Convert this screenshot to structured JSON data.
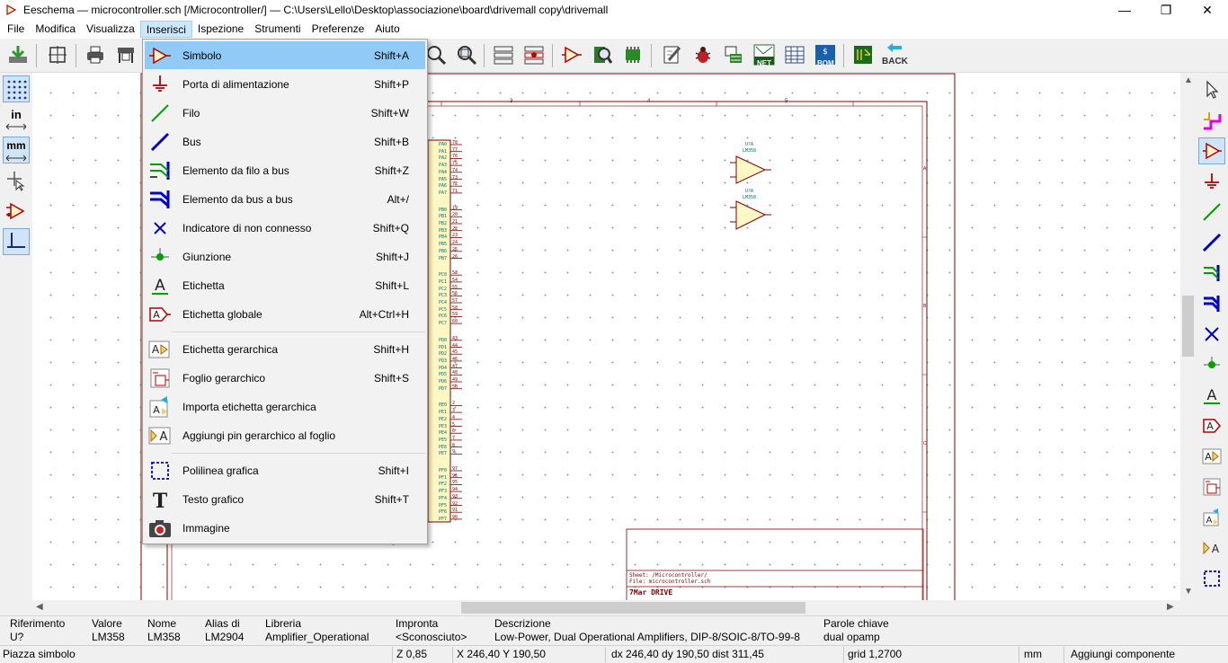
{
  "window": {
    "title": "Eeschema — microcontroller.sch [/Microcontroller/] — C:\\Users\\Lello\\Desktop\\associazione\\board\\drivemall copy\\drivemall",
    "minimize": "—",
    "restore": "❐",
    "close": "✕"
  },
  "menubar": [
    {
      "label": "File"
    },
    {
      "label": "Modifica"
    },
    {
      "label": "Visualizza"
    },
    {
      "label": "Inserisci"
    },
    {
      "label": "Ispezione"
    },
    {
      "label": "Strumenti"
    },
    {
      "label": "Preferenze"
    },
    {
      "label": "Aiuto"
    }
  ],
  "insert_menu": [
    {
      "label": "Simbolo",
      "shortcut": "Shift+A",
      "icon": "symbol-icon"
    },
    {
      "label": "Porta di alimentazione",
      "shortcut": "Shift+P",
      "icon": "power-port-icon"
    },
    {
      "label": "Filo",
      "shortcut": "Shift+W",
      "icon": "wire-icon"
    },
    {
      "label": "Bus",
      "shortcut": "Shift+B",
      "icon": "bus-icon"
    },
    {
      "label": "Elemento da filo a bus",
      "shortcut": "Shift+Z",
      "icon": "wire-to-bus-icon"
    },
    {
      "label": "Elemento da bus a bus",
      "shortcut": "Alt+/",
      "icon": "bus-to-bus-icon"
    },
    {
      "label": "Indicatore di non connesso",
      "shortcut": "Shift+Q",
      "icon": "no-connect-icon"
    },
    {
      "label": "Giunzione",
      "shortcut": "Shift+J",
      "icon": "junction-icon"
    },
    {
      "label": "Etichetta",
      "shortcut": "Shift+L",
      "icon": "label-icon"
    },
    {
      "label": "Etichetta globale",
      "shortcut": "Alt+Ctrl+H",
      "icon": "global-label-icon"
    },
    {
      "label": "Etichetta gerarchica",
      "shortcut": "Shift+H",
      "icon": "hier-label-icon"
    },
    {
      "label": "Foglio gerarchico",
      "shortcut": "Shift+S",
      "icon": "hier-sheet-icon"
    },
    {
      "label": "Importa etichetta gerarchica",
      "shortcut": "",
      "icon": "import-hier-label-icon"
    },
    {
      "label": "Aggiungi pin gerarchico al foglio",
      "shortcut": "",
      "icon": "add-hier-pin-icon"
    },
    {
      "label": "Polilinea grafica",
      "shortcut": "Shift+I",
      "icon": "polyline-icon"
    },
    {
      "label": "Testo grafico",
      "shortcut": "Shift+T",
      "icon": "text-icon"
    },
    {
      "label": "Immagine",
      "shortcut": "",
      "icon": "camera-icon"
    }
  ],
  "toolbar": {
    "back_label": "BACK",
    "net_label": "NET",
    "bom_label": "BOM"
  },
  "left_toolbar": {
    "units_in": "in",
    "units_mm": "mm"
  },
  "schematic": {
    "opamp1_ref": "U?A",
    "opamp1_val": "LM358",
    "opamp2_ref": "U?A",
    "opamp2_val": "LM358",
    "sheet_text": "Sheet: /Microcontroller/",
    "file_text": "File: microcontroller.sch",
    "title_text": "7Mar DRIVE",
    "frame_cols": [
      "3",
      "4",
      "5"
    ],
    "frame_rows": [
      "A",
      "B",
      "C"
    ],
    "ic_pins": [
      "PA0",
      "PA1",
      "PA2",
      "PA3",
      "PA4",
      "PA5",
      "PA6",
      "PA7",
      "PB0",
      "PB1",
      "PB2",
      "PB3",
      "PB4",
      "PB5",
      "PB6",
      "PB7",
      "PC0",
      "PC1",
      "PC2",
      "PC3",
      "PC4",
      "PC5",
      "PC6",
      "PC7",
      "PD0",
      "PD1",
      "PD2",
      "PD3",
      "PD4",
      "PD5",
      "PD6",
      "PD7",
      "PE0",
      "PE1",
      "PE2",
      "PE3",
      "PE4",
      "PE5",
      "PE6",
      "PE7",
      "PF0",
      "PF1",
      "PF2",
      "PF3",
      "PF4",
      "PF5",
      "PF6",
      "PF7"
    ],
    "ic_pin_numbers": [
      "78",
      "77",
      "76",
      "75",
      "74",
      "73",
      "72",
      "71",
      "19",
      "20",
      "21",
      "22",
      "23",
      "24",
      "25",
      "26",
      "53",
      "54",
      "55",
      "56",
      "57",
      "58",
      "59",
      "60",
      "43",
      "44",
      "45",
      "46",
      "47",
      "48",
      "49",
      "50",
      "2",
      "3",
      "4",
      "5",
      "6",
      "7",
      "8",
      "9",
      "97",
      "96",
      "95",
      "94",
      "93",
      "92",
      "91",
      "90"
    ],
    "ic_name": "ATmega2560-16AU"
  },
  "info_panel": [
    {
      "header": "Riferimento",
      "value": "U?"
    },
    {
      "header": "Valore",
      "value": "LM358"
    },
    {
      "header": "Nome",
      "value": "LM358"
    },
    {
      "header": "Alias di",
      "value": "LM2904"
    },
    {
      "header": "Libreria",
      "value": "Amplifier_Operational"
    },
    {
      "header": "Impronta",
      "value": "<Sconosciuto>"
    },
    {
      "header": "Descrizione",
      "value": "Low-Power, Dual Operational Amplifiers, DIP-8/SOIC-8/TO-99-8"
    },
    {
      "header": "Parole chiave",
      "value": "dual opamp"
    }
  ],
  "statusbar": {
    "message": "Piazza simbolo",
    "zoom": "Z 0,85",
    "coords": "X 246,40  Y 190,50",
    "delta": "dx 246,40  dy 190,50  dist 311,45",
    "grid": "grid 1,2700",
    "units": "mm",
    "mode": "Aggiungi componente"
  },
  "colors": {
    "accent": "#91c9f7",
    "schematic_red": "#800000",
    "schematic_teal": "#007070",
    "wire_green": "#00a000",
    "bus_blue": "#0000c8"
  }
}
